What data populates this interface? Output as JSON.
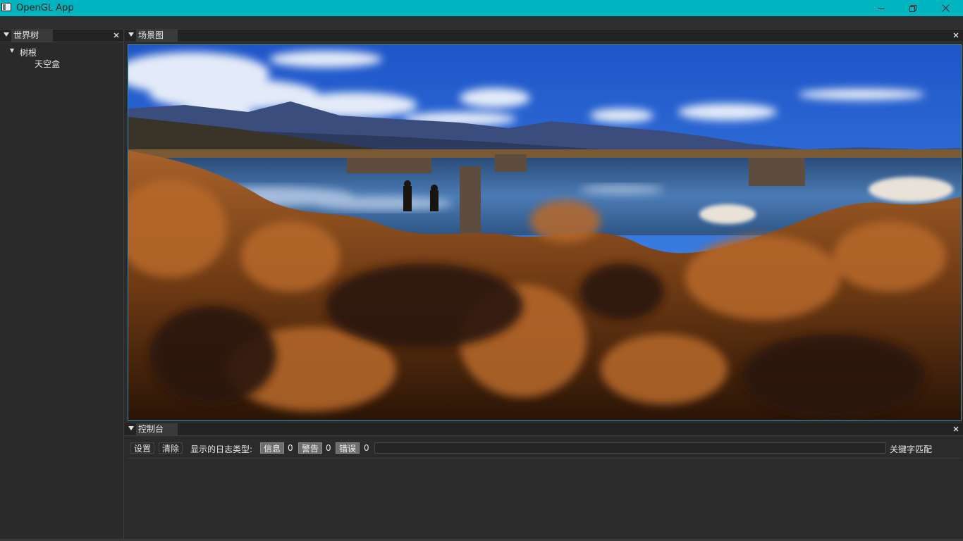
{
  "window": {
    "title": "OpenGL App",
    "accent_color": "#00b5c0"
  },
  "world_panel": {
    "tab_label": "世界树",
    "tree": {
      "root_label": "树根",
      "children": [
        "天空盒"
      ]
    }
  },
  "scene_panel": {
    "tab_label": "场景图"
  },
  "console_panel": {
    "tab_label": "控制台",
    "settings_label": "设置",
    "clear_label": "清除",
    "log_type_label": "显示的日志类型:",
    "filters": [
      {
        "label": "信息",
        "count": "0"
      },
      {
        "label": "警告",
        "count": "0"
      },
      {
        "label": "错误",
        "count": "0"
      }
    ],
    "search_value": "",
    "keyword_match_label": "关键字匹配"
  },
  "icons": {
    "minimize": "minimize-icon",
    "restore": "restore-icon",
    "close": "close-icon",
    "collapse": "triangle-down-icon"
  }
}
